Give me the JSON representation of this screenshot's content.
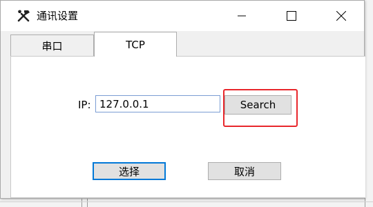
{
  "window": {
    "title": "通讯设置",
    "app_icon": "hammer-wrench-icon",
    "controls": [
      "minimize-icon",
      "maximize-icon",
      "close-icon"
    ]
  },
  "tabs": [
    {
      "label": "串口",
      "active": false
    },
    {
      "label": "TCP",
      "active": true
    }
  ],
  "tcp": {
    "ip_label": "IP:",
    "ip_value": "127.0.0.1",
    "search_label": "Search"
  },
  "actions": {
    "select_label": "选择",
    "cancel_label": "取消"
  },
  "colors": {
    "highlight": "#e8262b",
    "focus": "#0078d7"
  }
}
